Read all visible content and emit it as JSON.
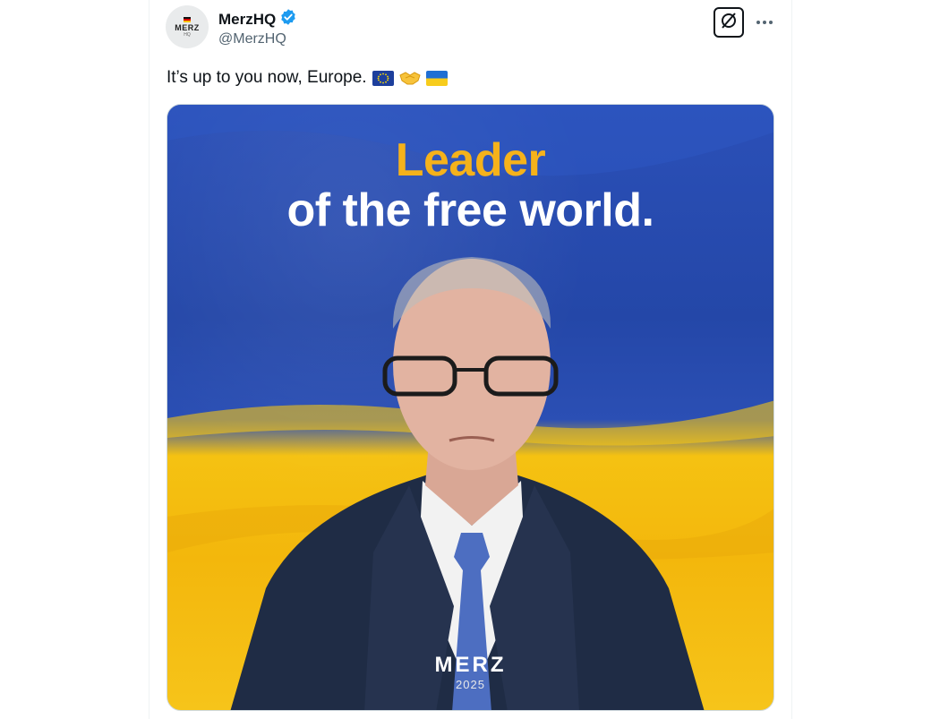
{
  "author": {
    "name": "MerzHQ",
    "handle": "@MerzHQ",
    "verified": true,
    "avatar_wordmark": "MERZ",
    "avatar_sub": "HQ"
  },
  "tweet": {
    "text": "It’s up to you now, Europe.",
    "emojis": [
      "eu-flag",
      "handshake",
      "ukraine-flag"
    ]
  },
  "actions": {
    "grok_icon": "grok-icon",
    "more_icon": "more-icon"
  },
  "media": {
    "headline_line1": "Leader",
    "headline_line2": "of the free world.",
    "logo": "MERZ",
    "logo_year": "2025",
    "colors": {
      "flag_blue": "#2447a8",
      "flag_yellow": "#f3b70c",
      "headline_accent": "#f5b21b"
    }
  }
}
